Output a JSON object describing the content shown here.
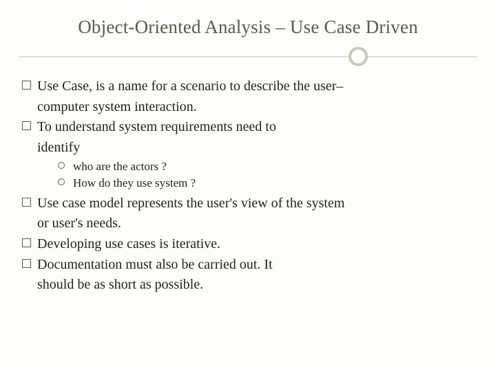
{
  "title": "Object-Oriented Analysis – Use Case Driven",
  "bullets": {
    "b1a": "Use Case, is a name for a scenario to describe the user–",
    "b1b": "computer system interaction.",
    "b2a": "To understand system requirements need to",
    "b2b": "identify",
    "sub1": "who are the actors ?",
    "sub2": "How do they use system ?",
    "b3a": "Use case model represents the user's view of the system",
    "b3b": "or user's needs.",
    "b4": "Developing use cases is iterative.",
    "b5a": "Documentation must also be carried out. It",
    "b5b": "should be as short as possible."
  }
}
